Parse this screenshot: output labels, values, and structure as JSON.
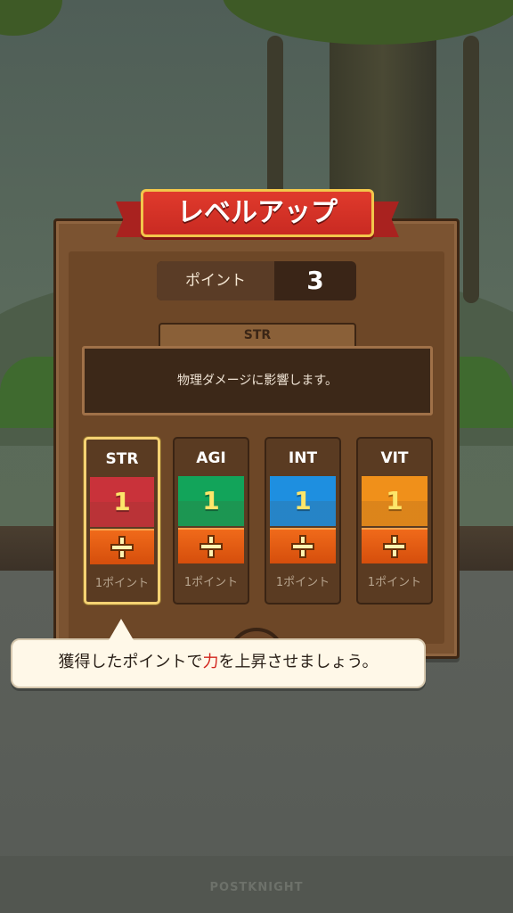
{
  "title": "レベルアップ",
  "points": {
    "label": "ポイント",
    "value": "3"
  },
  "description": {
    "tab_label": "STR",
    "text": "物理ダメージに影響します。"
  },
  "stats": [
    {
      "name": "STR",
      "value": "1",
      "cost": "1ポイント",
      "color": "#c9323a",
      "selected": true
    },
    {
      "name": "AGI",
      "value": "1",
      "cost": "1ポイント",
      "color": "#12a45a",
      "selected": false
    },
    {
      "name": "INT",
      "value": "1",
      "cost": "1ポイント",
      "color": "#1e8fe0",
      "selected": false
    },
    {
      "name": "VIT",
      "value": "1",
      "cost": "1ポイント",
      "color": "#f0901a",
      "selected": false
    }
  ],
  "tutorial": {
    "before": "獲得したポイントで",
    "highlight": "力",
    "after": "を上昇させましょう。"
  },
  "brand": "POSTKNIGHT",
  "colors": {
    "accent": "#d2241c",
    "panel": "#7b5331",
    "plus": "#e35a12"
  }
}
